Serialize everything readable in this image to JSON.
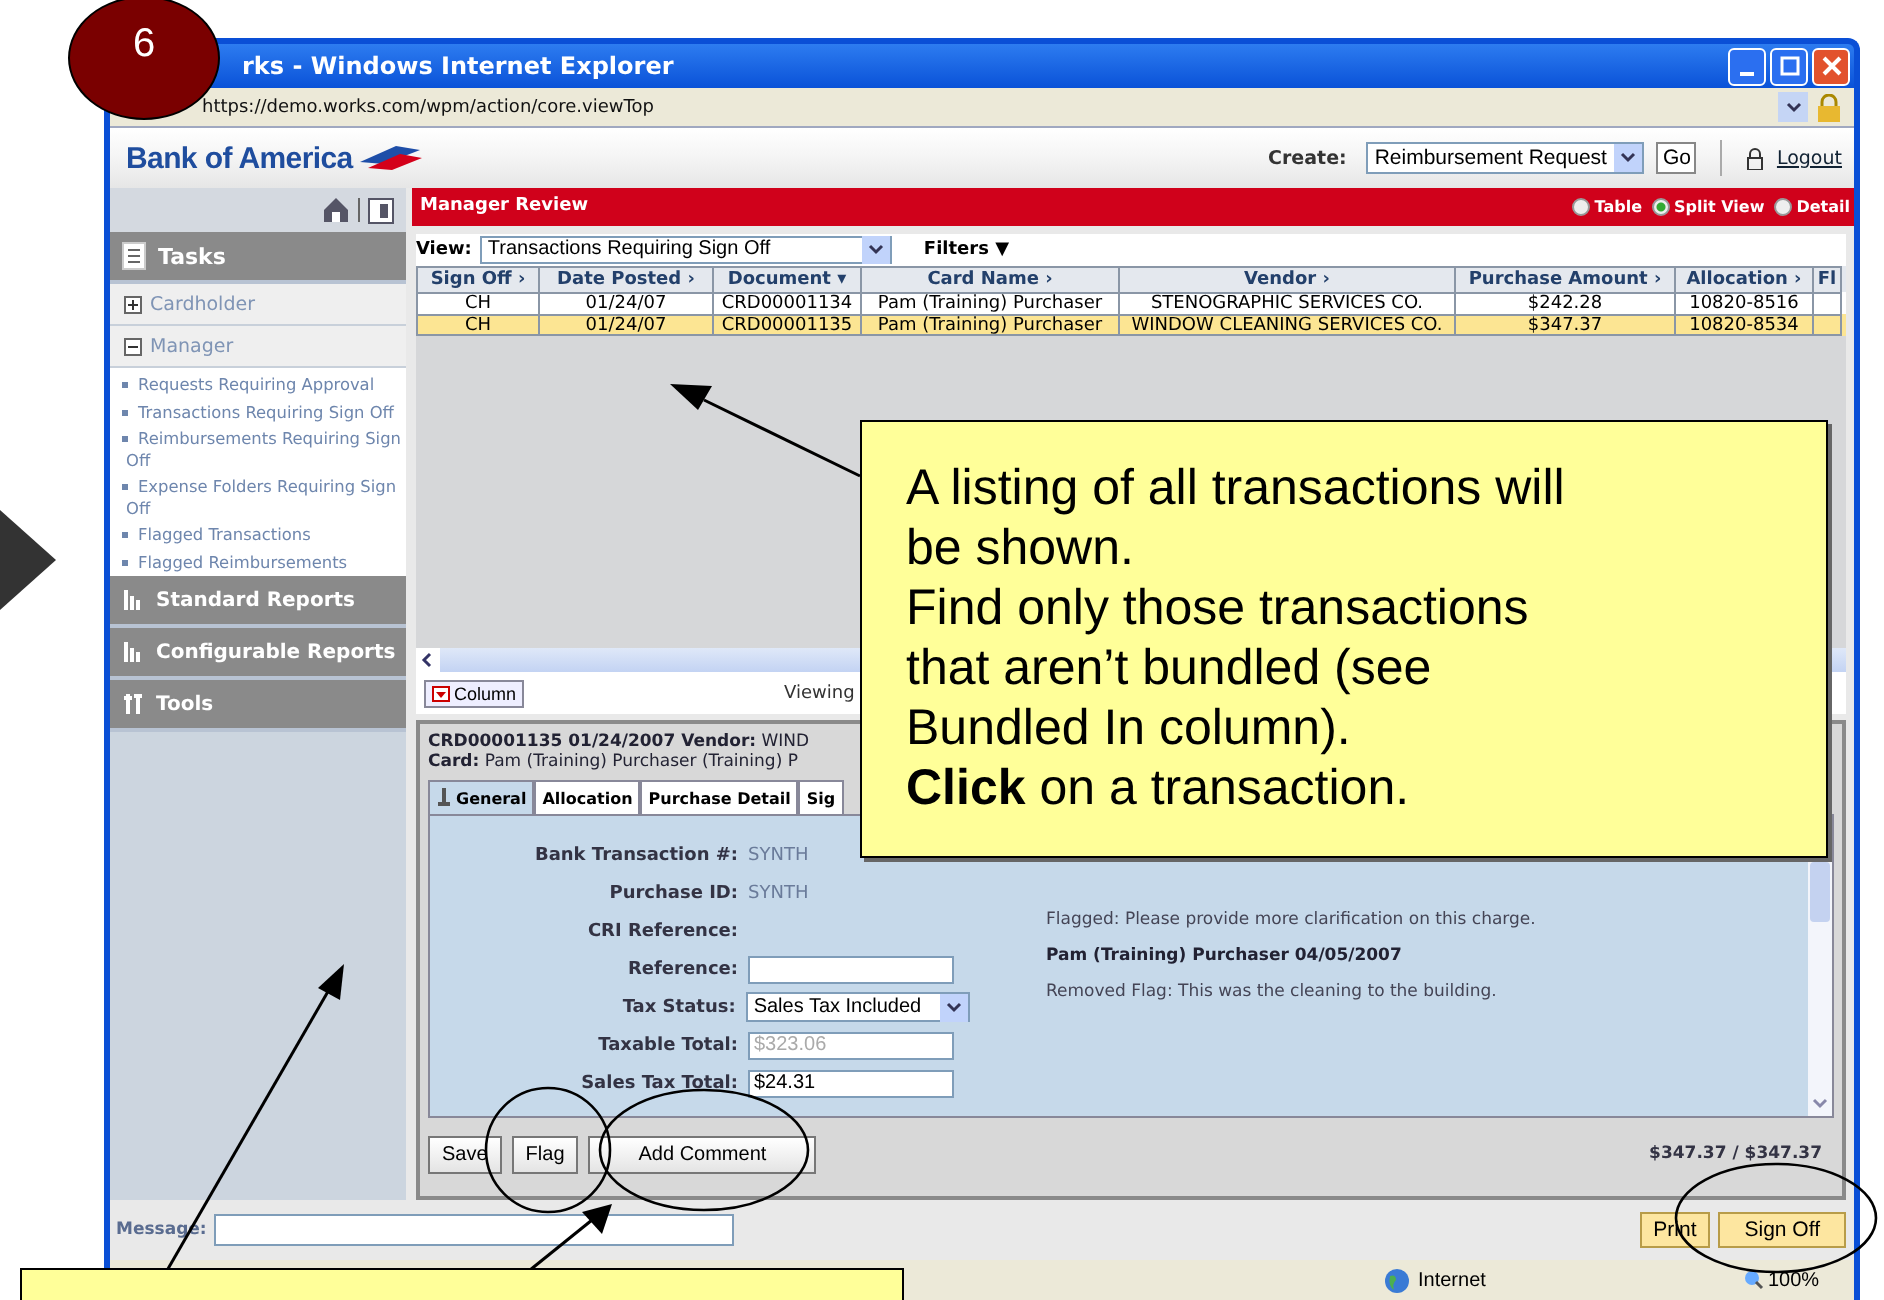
{
  "badge": "6",
  "window": {
    "title": "rks - Windows Internet Explorer",
    "address": "https://demo.works.com/wpm/action/core.viewTop"
  },
  "header": {
    "logo": "Bank of America",
    "create_label": "Create:",
    "create_value": "Reimbursement Request",
    "go": "Go",
    "logout": "Logout"
  },
  "sidebar": {
    "tasks": "Tasks",
    "groups": [
      {
        "label": "Cardholder",
        "expanded": false
      },
      {
        "label": "Manager",
        "expanded": true,
        "children": [
          {
            "label": "Requests Requiring Approval"
          },
          {
            "label": "Transactions Requiring Sign Off"
          },
          {
            "label": "Reimbursements Requiring Sign Off"
          },
          {
            "label": "Expense Folders Requiring Sign Off"
          },
          {
            "label": "Flagged Transactions"
          },
          {
            "label": "Flagged Reimbursements"
          }
        ]
      }
    ],
    "sections": [
      "Standard Reports",
      "Configurable Reports",
      "Tools"
    ]
  },
  "page_title": "Manager Review",
  "views": [
    {
      "label": "Table",
      "selected": false
    },
    {
      "label": "Split View",
      "selected": true
    },
    {
      "label": "Detail",
      "selected": false
    }
  ],
  "view_label": "View:",
  "view_value": "Transactions Requiring Sign Off",
  "filters": "Filters ▼",
  "table": {
    "columns": [
      "Sign Off ›",
      "Date Posted ›",
      "Document ▾",
      "Card Name ›",
      "Vendor ›",
      "Purchase Amount ›",
      "Allocation ›",
      "Fl"
    ],
    "rows": [
      {
        "selected": false,
        "cells": [
          "CH",
          "01/24/07",
          "CRD00001134",
          "Pam (Training) Purchaser",
          "STENOGRAPHIC SERVICES CO.",
          "$242.28",
          "10820-8516",
          ""
        ]
      },
      {
        "selected": true,
        "cells": [
          "CH",
          "01/24/07",
          "CRD00001135",
          "Pam (Training) Purchaser",
          "WINDOW CLEANING SERVICES CO.",
          "$347.37",
          "10820-8534",
          ""
        ]
      }
    ]
  },
  "column_button": "Column",
  "viewing": "Viewing",
  "detail": {
    "line1": "**CRD00001135  01/24/2007  Vendor:** WIND",
    "line2": "**Card:** Pam (Training) Purchaser  (Training) P",
    "tabs": [
      {
        "label": "General",
        "selected": true
      },
      {
        "label": "Allocation",
        "selected": false
      },
      {
        "label": "Purchase Detail",
        "selected": false
      },
      {
        "label": "Sig",
        "selected": false
      }
    ],
    "fields": [
      {
        "kind": "text",
        "label": "Bank Transaction #:",
        "value": "SYNTH"
      },
      {
        "kind": "text",
        "label": "Purchase ID:",
        "value": "SYNTH"
      },
      {
        "kind": "text",
        "label": "CRI Reference:"
      },
      {
        "kind": "input",
        "label": "Reference:"
      },
      {
        "kind": "select",
        "label": "Tax Status:",
        "value": "Sales Tax Included"
      },
      {
        "kind": "input",
        "label": "Taxable Total:",
        "value": "$323.06",
        "disabled": true
      },
      {
        "kind": "input",
        "label": "Sales Tax Total:",
        "value": "$24.31"
      }
    ],
    "comments": [
      {
        "kind": "plain",
        "text": "Flagged: Please provide more clarification on this charge."
      },
      {
        "kind": "author",
        "text": "Pam (Training) Purchaser    04/05/2007"
      },
      {
        "kind": "plain",
        "text": "Removed Flag: This was the cleaning to the building."
      }
    ],
    "buttons": [
      "Save",
      "Flag",
      "Add Comment"
    ],
    "total": "$347.37 / $347.37"
  },
  "message_label": "Message:",
  "actions": [
    "Print",
    "Sign Off"
  ],
  "status_bar": {
    "zone": "Internet",
    "zoom": "100%"
  },
  "callout": {
    "lines": [
      "A listing of all transactions will",
      "be shown.",
      "Find only those transactions",
      "that aren’t bundled (see",
      "Bundled In column).",
      "**Click** on a transaction."
    ]
  }
}
